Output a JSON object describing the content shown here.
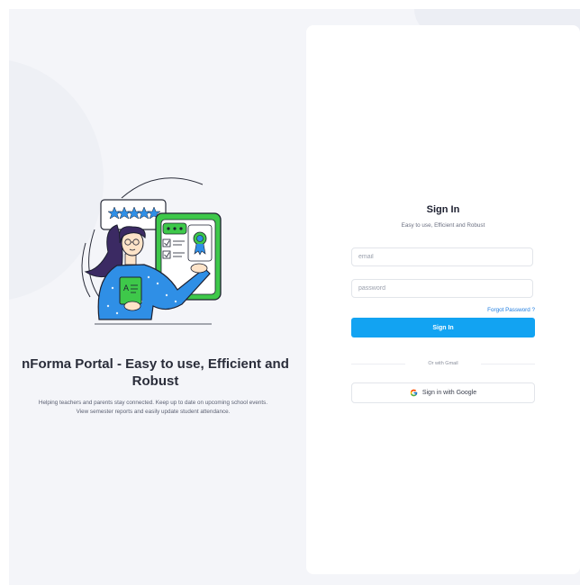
{
  "hero": {
    "title": "nForma Portal - Easy to use, Efficient and Robust",
    "description_line1": "Helping teachers and parents stay connected. Keep up to date on upcoming school events.",
    "description_line2": "View semester reports and easily update student attendance."
  },
  "signin": {
    "title": "Sign In",
    "subtitle": "Easy to use, Efficient and Robust",
    "email_placeholder": "email",
    "password_placeholder": "password",
    "forgot_label": "Forgot Password ?",
    "submit_label": "Sign In",
    "divider_label": "Or with Gmail",
    "google_label": "Sign in with Google"
  },
  "colors": {
    "primary": "#12a3f2",
    "link": "#1f7de0",
    "background": "#f4f5f9",
    "illustration_green": "#3ec84a",
    "illustration_blue": "#2f8fe6",
    "illustration_purple": "#3b2a63"
  },
  "icons": {
    "google": "google-g-icon",
    "illustration": "teacher-illustration"
  }
}
